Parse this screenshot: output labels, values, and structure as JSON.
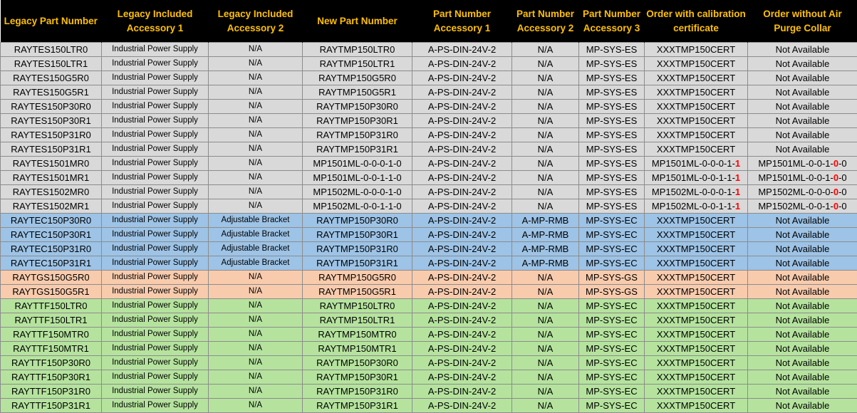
{
  "headers": [
    "Legacy Part Number",
    "Legacy Included Accessory 1",
    "Legacy Included Accessory 2",
    "New Part Number",
    "Part Number Accessory 1",
    "Part Number Accessory 2",
    "Part Number Accessory 3",
    "Order with calibration certificate",
    "Order without Air Purge Collar"
  ],
  "colors": {
    "header_bg": "#000000",
    "header_text": "#ffc000",
    "grey": "#d9d9d9",
    "blue": "#9dc3e6",
    "orange": "#f8cbad",
    "green": "#b5e39e",
    "highlight_digit": "#ff0000"
  },
  "rows": [
    {
      "group": "grey",
      "legacy": "RAYTES150LTR0",
      "acc1": "Industrial Power Supply",
      "acc2": "N/A",
      "new": "RAYTMP150LTR0",
      "pn1": "A-PS-DIN-24V-2",
      "pn2": "N/A",
      "pn3": "MP-SYS-ES",
      "cal": "XXXTMP150CERT",
      "cal_red": "",
      "noair": "Not Available",
      "noair_red": "",
      "noair_tail": ""
    },
    {
      "group": "grey",
      "legacy": "RAYTES150LTR1",
      "acc1": "Industrial Power Supply",
      "acc2": "N/A",
      "new": "RAYTMP150LTR1",
      "pn1": "A-PS-DIN-24V-2",
      "pn2": "N/A",
      "pn3": "MP-SYS-ES",
      "cal": "XXXTMP150CERT",
      "cal_red": "",
      "noair": "Not Available",
      "noair_red": "",
      "noair_tail": ""
    },
    {
      "group": "grey",
      "legacy": "RAYTES150G5R0",
      "acc1": "Industrial Power Supply",
      "acc2": "N/A",
      "new": "RAYTMP150G5R0",
      "pn1": "A-PS-DIN-24V-2",
      "pn2": "N/A",
      "pn3": "MP-SYS-ES",
      "cal": "XXXTMP150CERT",
      "cal_red": "",
      "noair": "Not Available",
      "noair_red": "",
      "noair_tail": ""
    },
    {
      "group": "grey",
      "legacy": "RAYTES150G5R1",
      "acc1": "Industrial Power Supply",
      "acc2": "N/A",
      "new": "RAYTMP150G5R1",
      "pn1": "A-PS-DIN-24V-2",
      "pn2": "N/A",
      "pn3": "MP-SYS-ES",
      "cal": "XXXTMP150CERT",
      "cal_red": "",
      "noair": "Not Available",
      "noair_red": "",
      "noair_tail": ""
    },
    {
      "group": "grey",
      "legacy": "RAYTES150P30R0",
      "acc1": "Industrial Power Supply",
      "acc2": "N/A",
      "new": "RAYTMP150P30R0",
      "pn1": "A-PS-DIN-24V-2",
      "pn2": "N/A",
      "pn3": "MP-SYS-ES",
      "cal": "XXXTMP150CERT",
      "cal_red": "",
      "noair": "Not Available",
      "noair_red": "",
      "noair_tail": ""
    },
    {
      "group": "grey",
      "legacy": "RAYTES150P30R1",
      "acc1": "Industrial Power Supply",
      "acc2": "N/A",
      "new": "RAYTMP150P30R1",
      "pn1": "A-PS-DIN-24V-2",
      "pn2": "N/A",
      "pn3": "MP-SYS-ES",
      "cal": "XXXTMP150CERT",
      "cal_red": "",
      "noair": "Not Available",
      "noair_red": "",
      "noair_tail": ""
    },
    {
      "group": "grey",
      "legacy": "RAYTES150P31R0",
      "acc1": "Industrial Power Supply",
      "acc2": "N/A",
      "new": "RAYTMP150P31R0",
      "pn1": "A-PS-DIN-24V-2",
      "pn2": "N/A",
      "pn3": "MP-SYS-ES",
      "cal": "XXXTMP150CERT",
      "cal_red": "",
      "noair": "Not Available",
      "noair_red": "",
      "noair_tail": ""
    },
    {
      "group": "grey",
      "legacy": "RAYTES150P31R1",
      "acc1": "Industrial Power Supply",
      "acc2": "N/A",
      "new": "RAYTMP150P31R1",
      "pn1": "A-PS-DIN-24V-2",
      "pn2": "N/A",
      "pn3": "MP-SYS-ES",
      "cal": "XXXTMP150CERT",
      "cal_red": "",
      "noair": "Not Available",
      "noair_red": "",
      "noair_tail": ""
    },
    {
      "group": "grey",
      "legacy": "RAYTES1501MR0",
      "acc1": "Industrial Power Supply",
      "acc2": "N/A",
      "new": "MP1501ML-0-0-0-1-0",
      "pn1": "A-PS-DIN-24V-2",
      "pn2": "N/A",
      "pn3": "MP-SYS-ES",
      "cal": "MP1501ML-0-0-0-1-",
      "cal_red": "1",
      "noair": "MP1501ML-0-0-1-",
      "noair_red": "0",
      "noair_tail": "-0"
    },
    {
      "group": "grey",
      "legacy": "RAYTES1501MR1",
      "acc1": "Industrial Power Supply",
      "acc2": "N/A",
      "new": "MP1501ML-0-0-1-1-0",
      "pn1": "A-PS-DIN-24V-2",
      "pn2": "N/A",
      "pn3": "MP-SYS-ES",
      "cal": "MP1501ML-0-0-1-1-",
      "cal_red": "1",
      "noair": "MP1501ML-0-0-1-",
      "noair_red": "0",
      "noair_tail": "-0"
    },
    {
      "group": "grey",
      "legacy": "RAYTES1502MR0",
      "acc1": "Industrial Power Supply",
      "acc2": "N/A",
      "new": "MP1502ML-0-0-0-1-0",
      "pn1": "A-PS-DIN-24V-2",
      "pn2": "N/A",
      "pn3": "MP-SYS-ES",
      "cal": "MP1502ML-0-0-0-1-",
      "cal_red": "1",
      "noair": "MP1502ML-0-0-0-",
      "noair_red": "0",
      "noair_tail": "-0"
    },
    {
      "group": "grey",
      "legacy": "RAYTES1502MR1",
      "acc1": "Industrial Power Supply",
      "acc2": "N/A",
      "new": "MP1502ML-0-0-1-1-0",
      "pn1": "A-PS-DIN-24V-2",
      "pn2": "N/A",
      "pn3": "MP-SYS-ES",
      "cal": "MP1502ML-0-0-1-1-",
      "cal_red": "1",
      "noair": "MP1502ML-0-0-1-",
      "noair_red": "0",
      "noair_tail": "-0"
    },
    {
      "group": "blue",
      "legacy": "RAYTEC150P30R0",
      "acc1": "Industrial Power Supply",
      "acc2": "Adjustable Bracket",
      "new": "RAYTMP150P30R0",
      "pn1": "A-PS-DIN-24V-2",
      "pn2": "A-MP-RMB",
      "pn3": "MP-SYS-EC",
      "cal": "XXXTMP150CERT",
      "cal_red": "",
      "noair": "Not Available",
      "noair_red": "",
      "noair_tail": ""
    },
    {
      "group": "blue",
      "legacy": "RAYTEC150P30R1",
      "acc1": "Industrial Power Supply",
      "acc2": "Adjustable Bracket",
      "new": "RAYTMP150P30R1",
      "pn1": "A-PS-DIN-24V-2",
      "pn2": "A-MP-RMB",
      "pn3": "MP-SYS-EC",
      "cal": "XXXTMP150CERT",
      "cal_red": "",
      "noair": "Not Available",
      "noair_red": "",
      "noair_tail": ""
    },
    {
      "group": "blue",
      "legacy": "RAYTEC150P31R0",
      "acc1": "Industrial Power Supply",
      "acc2": "Adjustable Bracket",
      "new": "RAYTMP150P31R0",
      "pn1": "A-PS-DIN-24V-2",
      "pn2": "A-MP-RMB",
      "pn3": "MP-SYS-EC",
      "cal": "XXXTMP150CERT",
      "cal_red": "",
      "noair": "Not Available",
      "noair_red": "",
      "noair_tail": ""
    },
    {
      "group": "blue",
      "legacy": "RAYTEC150P31R1",
      "acc1": "Industrial Power Supply",
      "acc2": "Adjustable Bracket",
      "new": "RAYTMP150P31R1",
      "pn1": "A-PS-DIN-24V-2",
      "pn2": "A-MP-RMB",
      "pn3": "MP-SYS-EC",
      "cal": "XXXTMP150CERT",
      "cal_red": "",
      "noair": "Not Available",
      "noair_red": "",
      "noair_tail": ""
    },
    {
      "group": "orange",
      "legacy": "RAYTGS150G5R0",
      "acc1": "Industrial Power Supply",
      "acc2": "N/A",
      "new": "RAYTMP150G5R0",
      "pn1": "A-PS-DIN-24V-2",
      "pn2": "N/A",
      "pn3": "MP-SYS-GS",
      "cal": "XXXTMP150CERT",
      "cal_red": "",
      "noair": "Not Available",
      "noair_red": "",
      "noair_tail": ""
    },
    {
      "group": "orange",
      "legacy": "RAYTGS150G5R1",
      "acc1": "Industrial Power Supply",
      "acc2": "N/A",
      "new": "RAYTMP150G5R1",
      "pn1": "A-PS-DIN-24V-2",
      "pn2": "N/A",
      "pn3": "MP-SYS-GS",
      "cal": "XXXTMP150CERT",
      "cal_red": "",
      "noair": "Not Available",
      "noair_red": "",
      "noair_tail": ""
    },
    {
      "group": "green",
      "legacy": "RAYTTF150LTR0",
      "acc1": "Industrial Power Supply",
      "acc2": "N/A",
      "new": "RAYTMP150LTR0",
      "pn1": "A-PS-DIN-24V-2",
      "pn2": "N/A",
      "pn3": "MP-SYS-EC",
      "cal": "XXXTMP150CERT",
      "cal_red": "",
      "noair": "Not Available",
      "noair_red": "",
      "noair_tail": ""
    },
    {
      "group": "green",
      "legacy": "RAYTTF150LTR1",
      "acc1": "Industrial Power Supply",
      "acc2": "N/A",
      "new": "RAYTMP150LTR1",
      "pn1": "A-PS-DIN-24V-2",
      "pn2": "N/A",
      "pn3": "MP-SYS-EC",
      "cal": "XXXTMP150CERT",
      "cal_red": "",
      "noair": "Not Available",
      "noair_red": "",
      "noair_tail": ""
    },
    {
      "group": "green",
      "legacy": "RAYTTF150MTR0",
      "acc1": "Industrial Power Supply",
      "acc2": "N/A",
      "new": "RAYTMP150MTR0",
      "pn1": "A-PS-DIN-24V-2",
      "pn2": "N/A",
      "pn3": "MP-SYS-EC",
      "cal": "XXXTMP150CERT",
      "cal_red": "",
      "noair": "Not Available",
      "noair_red": "",
      "noair_tail": ""
    },
    {
      "group": "green",
      "legacy": "RAYTTF150MTR1",
      "acc1": "Industrial Power Supply",
      "acc2": "N/A",
      "new": "RAYTMP150MTR1",
      "pn1": "A-PS-DIN-24V-2",
      "pn2": "N/A",
      "pn3": "MP-SYS-EC",
      "cal": "XXXTMP150CERT",
      "cal_red": "",
      "noair": "Not Available",
      "noair_red": "",
      "noair_tail": ""
    },
    {
      "group": "green",
      "legacy": "RAYTTF150P30R0",
      "acc1": "Industrial Power Supply",
      "acc2": "N/A",
      "new": "RAYTMP150P30R0",
      "pn1": "A-PS-DIN-24V-2",
      "pn2": "N/A",
      "pn3": "MP-SYS-EC",
      "cal": "XXXTMP150CERT",
      "cal_red": "",
      "noair": "Not Available",
      "noair_red": "",
      "noair_tail": ""
    },
    {
      "group": "green",
      "legacy": "RAYTTF150P30R1",
      "acc1": "Industrial Power Supply",
      "acc2": "N/A",
      "new": "RAYTMP150P30R1",
      "pn1": "A-PS-DIN-24V-2",
      "pn2": "N/A",
      "pn3": "MP-SYS-EC",
      "cal": "XXXTMP150CERT",
      "cal_red": "",
      "noair": "Not Available",
      "noair_red": "",
      "noair_tail": ""
    },
    {
      "group": "green",
      "legacy": "RAYTTF150P31R0",
      "acc1": "Industrial Power Supply",
      "acc2": "N/A",
      "new": "RAYTMP150P31R0",
      "pn1": "A-PS-DIN-24V-2",
      "pn2": "N/A",
      "pn3": "MP-SYS-EC",
      "cal": "XXXTMP150CERT",
      "cal_red": "",
      "noair": "Not Available",
      "noair_red": "",
      "noair_tail": ""
    },
    {
      "group": "green",
      "legacy": "RAYTTF150P31R1",
      "acc1": "Industrial Power Supply",
      "acc2": "N/A",
      "new": "RAYTMP150P31R1",
      "pn1": "A-PS-DIN-24V-2",
      "pn2": "N/A",
      "pn3": "MP-SYS-EC",
      "cal": "XXXTMP150CERT",
      "cal_red": "",
      "noair": "Not Available",
      "noair_red": "",
      "noair_tail": ""
    }
  ]
}
